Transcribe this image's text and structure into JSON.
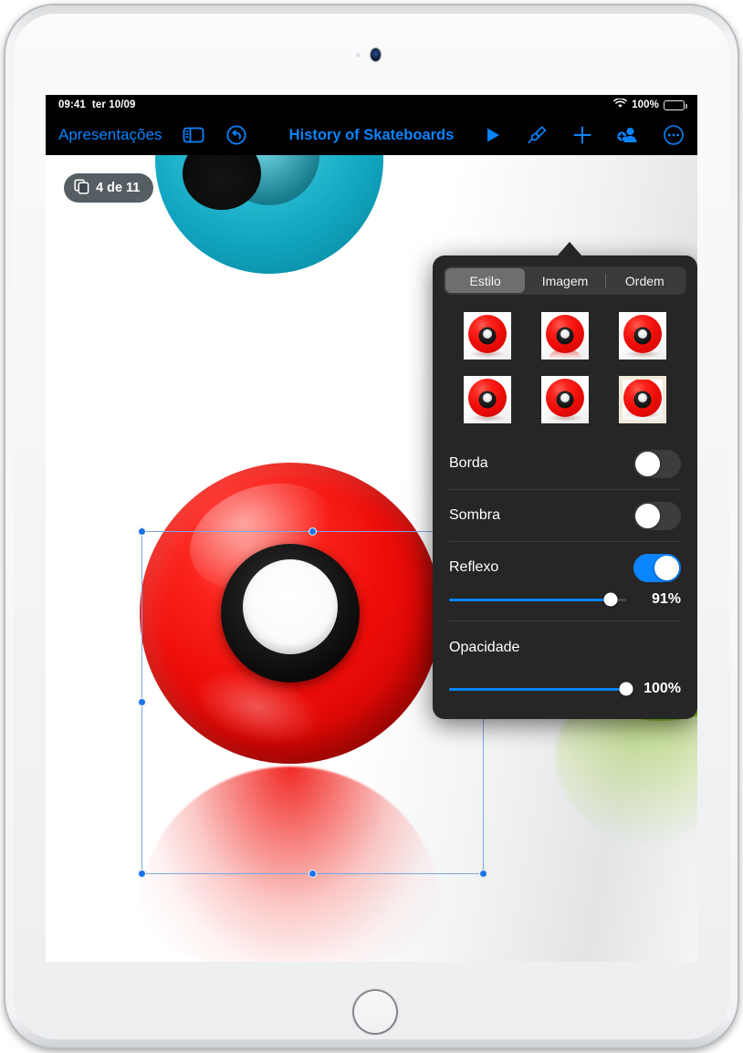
{
  "status_bar": {
    "time": "09:41",
    "date": "ter 10/09",
    "wifi_icon": "wifi-icon",
    "battery_percent": "100%",
    "battery_icon": "battery-full-icon"
  },
  "toolbar": {
    "back_label": "Apresentações",
    "sidebar_icon": "sidebar-icon",
    "undo_icon": "undo-icon",
    "document_title": "History of Skateboards",
    "play_icon": "play-icon",
    "format_icon": "paintbrush-icon",
    "add_icon": "plus-icon",
    "collaborate_icon": "add-person-icon",
    "more_icon": "ellipsis-icon",
    "accent_color": "#0a84ff"
  },
  "canvas": {
    "slide_counter": {
      "icon": "duplicate-slides-icon",
      "label": "4 de 11"
    },
    "selection": {
      "handle_count": 8,
      "handle_color": "#1a73e8",
      "frame_color": "#7aa7e8"
    },
    "objects": [
      {
        "name": "cyan-wheel",
        "color": "#17b2c9"
      },
      {
        "name": "red-wheel",
        "color": "#ee0d09",
        "selected": true
      },
      {
        "name": "green-wheel",
        "color": "#8ecb1c"
      }
    ]
  },
  "popover": {
    "tabs": [
      {
        "label": "Estilo",
        "active": true
      },
      {
        "label": "Imagem",
        "active": false
      },
      {
        "label": "Ordem",
        "active": false
      }
    ],
    "styles": [
      {
        "name": "style-1",
        "selected": false
      },
      {
        "name": "style-2",
        "selected": false
      },
      {
        "name": "style-3",
        "selected": false
      },
      {
        "name": "style-4",
        "selected": false
      },
      {
        "name": "style-5",
        "selected": false
      },
      {
        "name": "style-6",
        "selected": true
      }
    ],
    "options": [
      {
        "label": "Borda",
        "toggle": "off"
      },
      {
        "label": "Sombra",
        "toggle": "off"
      },
      {
        "label": "Reflexo",
        "toggle": "on"
      }
    ],
    "reflexo": {
      "label": "Reflexo",
      "enabled": true,
      "value": "91%",
      "percent": 91
    },
    "opacidade": {
      "label": "Opacidade",
      "value": "100%",
      "percent": 100
    },
    "accent_color": "#0a84ff",
    "background_color": "#262626",
    "selected_style_border": "#efe9d8"
  }
}
